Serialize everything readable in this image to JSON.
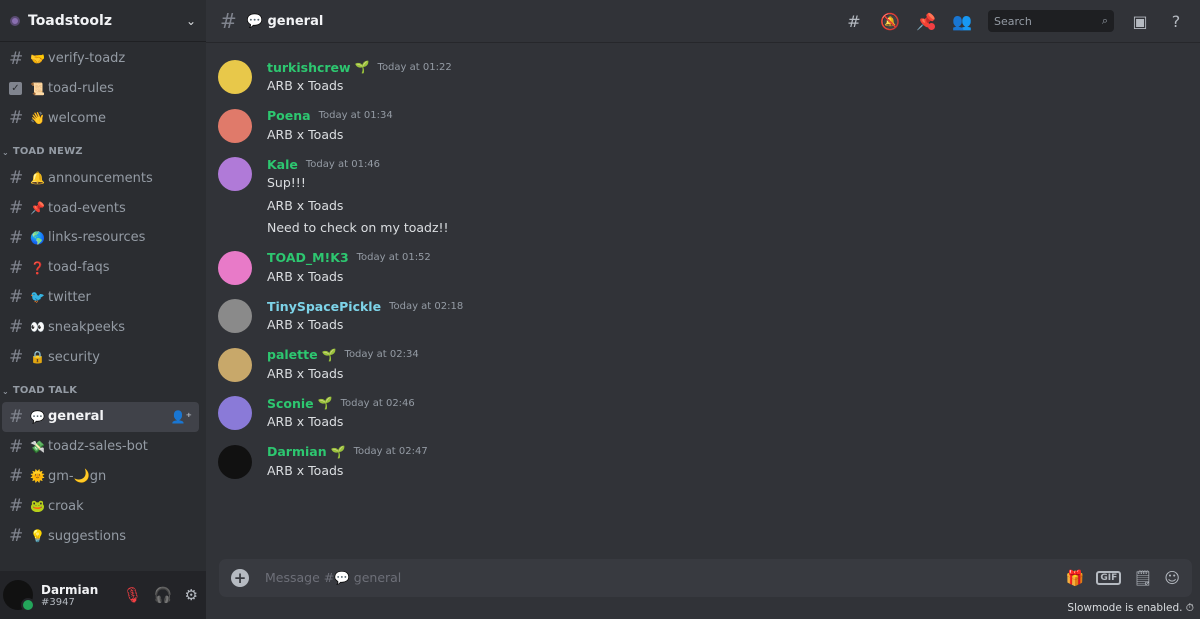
{
  "server": {
    "name": "Toadstoolz"
  },
  "channels_top": [
    {
      "name": "verify-toadz",
      "emoji": "🤝",
      "kind": "hash"
    },
    {
      "name": "toad-rules",
      "emoji": "📜",
      "kind": "check"
    },
    {
      "name": "welcome",
      "emoji": "👋",
      "kind": "hash"
    }
  ],
  "category1": {
    "name": "TOAD NEWZ"
  },
  "channels_newz": [
    {
      "name": "announcements",
      "emoji": "🔔"
    },
    {
      "name": "toad-events",
      "emoji": "📌"
    },
    {
      "name": "links-resources",
      "emoji": "🌎"
    },
    {
      "name": "toad-faqs",
      "emoji": "❓"
    },
    {
      "name": "twitter",
      "emoji": "🐦"
    },
    {
      "name": "sneakpeeks",
      "emoji": "👀"
    },
    {
      "name": "security",
      "emoji": "🔒"
    }
  ],
  "category2": {
    "name": "TOAD TALK"
  },
  "channels_talk": [
    {
      "name": "general",
      "emoji": "💬",
      "active": true
    },
    {
      "name": "toadz-sales-bot",
      "emoji": "💸"
    },
    {
      "name": "gm-🌙gn",
      "emoji": "🌞"
    },
    {
      "name": "croak",
      "emoji": "🐸"
    },
    {
      "name": "suggestions",
      "emoji": "💡"
    }
  ],
  "user": {
    "name": "Darmian",
    "tag": "#3947"
  },
  "header": {
    "channel": "💬 general",
    "search_placeholder": "Search"
  },
  "messages": [
    {
      "author": "turkishcrew",
      "badge": true,
      "time": "Today at 01:22",
      "lines": [
        "ARB x Toads"
      ],
      "avatar": "#e8c84a",
      "color": "#2dc770"
    },
    {
      "author": "Poena",
      "badge": false,
      "time": "Today at 01:34",
      "lines": [
        "ARB x Toads"
      ],
      "avatar": "#e07a6a",
      "color": "#2dc770"
    },
    {
      "author": "Kale",
      "badge": false,
      "time": "Today at 01:46",
      "lines": [
        "Sup!!!",
        "ARB x Toads",
        "Need to check on my toadz!!"
      ],
      "avatar": "#b07ad8",
      "color": "#2dc770"
    },
    {
      "author": "TOAD_M!K3",
      "badge": false,
      "time": "Today at 01:52",
      "lines": [
        "ARB x Toads"
      ],
      "avatar": "#e87ac8",
      "color": "#2dc770"
    },
    {
      "author": "TinySpacePickle",
      "badge": false,
      "time": "Today at 02:18",
      "lines": [
        "ARB x Toads"
      ],
      "avatar": "#8a8a8a",
      "color": "#7dd3e8"
    },
    {
      "author": "palette",
      "badge": true,
      "time": "Today at 02:34",
      "lines": [
        "ARB x Toads"
      ],
      "avatar": "#c8a86a",
      "color": "#2dc770"
    },
    {
      "author": "Sconie",
      "badge": true,
      "time": "Today at 02:46",
      "lines": [
        "ARB x Toads"
      ],
      "avatar": "#8a7ad8",
      "color": "#2dc770"
    },
    {
      "author": "Darmian",
      "badge": true,
      "time": "Today at 02:47",
      "lines": [
        "ARB x Toads"
      ],
      "avatar": "#111111",
      "color": "#2dc770"
    }
  ],
  "composer": {
    "placeholder": "Message #💬 general",
    "slowmode": "Slowmode is enabled."
  }
}
